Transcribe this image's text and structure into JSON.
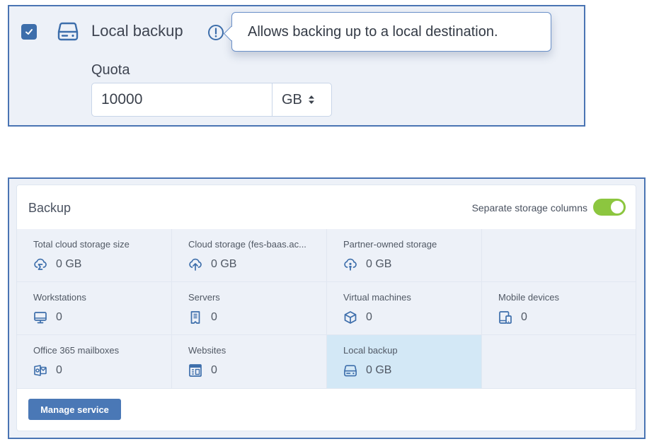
{
  "quota_panel": {
    "checkbox_checked": true,
    "service_icon": "hard-drive-icon",
    "service_label": "Local backup",
    "info_icon": "info-exclamation-icon",
    "tooltip_text": "Allows backing up to a local destination.",
    "quota_label": "Quota",
    "quota_value": "10000",
    "quota_unit": "GB",
    "unit_selector_icon": "sort-arrows-icon"
  },
  "backup_card": {
    "title": "Backup",
    "toggle_label": "Separate storage columns",
    "toggle_on": true,
    "cells": [
      {
        "label": "Total cloud storage size",
        "value": "0 GB",
        "icon": "cloud-sigma-icon"
      },
      {
        "label": "Cloud storage (fes-baas.ac...",
        "value": "0 GB",
        "icon": "cloud-upload-icon"
      },
      {
        "label": "Partner-owned storage",
        "value": "0 GB",
        "icon": "cloud-partner-icon"
      },
      {
        "label": "",
        "value": "",
        "icon": ""
      },
      {
        "label": "Workstations",
        "value": "0",
        "icon": "monitor-icon"
      },
      {
        "label": "Servers",
        "value": "0",
        "icon": "server-icon"
      },
      {
        "label": "Virtual machines",
        "value": "0",
        "icon": "cube-icon"
      },
      {
        "label": "Mobile devices",
        "value": "0",
        "icon": "mobile-devices-icon"
      },
      {
        "label": "Office 365 mailboxes",
        "value": "0",
        "icon": "outlook-mailbox-icon"
      },
      {
        "label": "Websites",
        "value": "0",
        "icon": "website-icon"
      },
      {
        "label": "Local backup",
        "value": "0 GB",
        "icon": "hard-drive-icon",
        "highlighted": true
      },
      {
        "label": "",
        "value": "",
        "icon": ""
      }
    ],
    "manage_button_label": "Manage service"
  },
  "colors": {
    "accent": "#3d6eab",
    "panel_border": "#4a74b3",
    "toggle_on": "#8cc63f",
    "highlight_cell": "#d3e8f6",
    "button": "#4a78b6"
  }
}
